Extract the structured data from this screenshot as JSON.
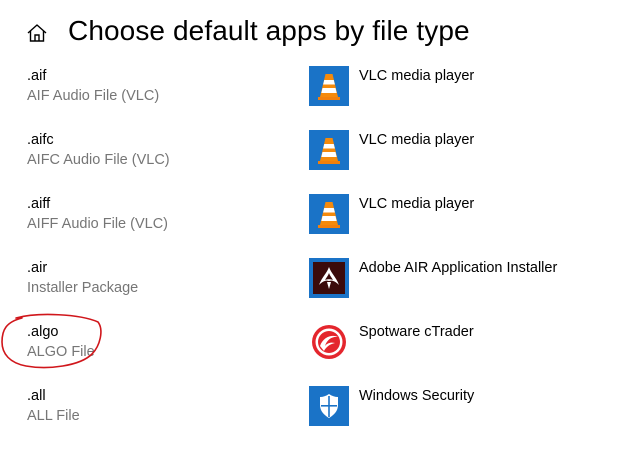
{
  "header": {
    "title": "Choose default apps by file type",
    "home_icon": "home-icon"
  },
  "colors": {
    "tile_blue": "#1a73c7",
    "air_tile": "#3b0b0b",
    "annotation_red": "#d0161b",
    "secondary_text": "#767676"
  },
  "rows": [
    {
      "extension": ".aif",
      "description": "AIF Audio File (VLC)",
      "app": "VLC media player",
      "icon": "vlc-icon"
    },
    {
      "extension": ".aifc",
      "description": "AIFC Audio File (VLC)",
      "app": "VLC media player",
      "icon": "vlc-icon"
    },
    {
      "extension": ".aiff",
      "description": "AIFF Audio File (VLC)",
      "app": "VLC media player",
      "icon": "vlc-icon"
    },
    {
      "extension": ".air",
      "description": "Installer Package",
      "app": "Adobe AIR Application Installer",
      "icon": "adobe-air-icon"
    },
    {
      "extension": ".algo",
      "description": "ALGO File",
      "app": "Spotware cTrader",
      "icon": "ctrader-icon"
    },
    {
      "extension": ".all",
      "description": "ALL File",
      "app": "Windows Security",
      "icon": "windows-security-icon"
    }
  ]
}
